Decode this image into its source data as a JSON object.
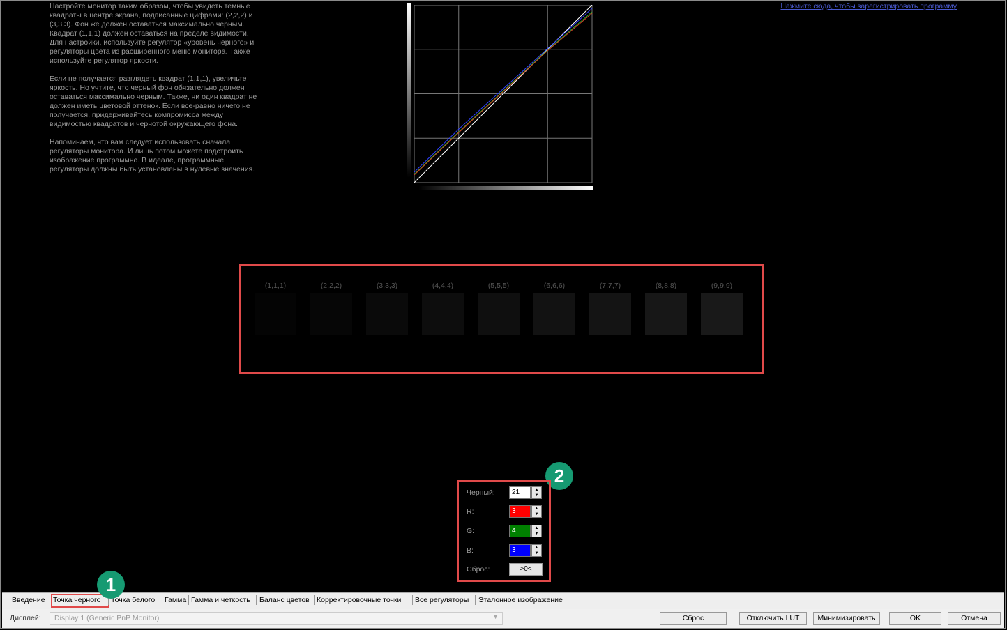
{
  "instructions": {
    "p1": "Настройте монитор таким образом, чтобы увидеть темные квадраты в центре экрана, подписанные цифрами: (2,2,2) и (3,3,3). Фон же должен оставаться максимально черным. Квадрат (1,1,1) должен оставаться на пределе видимости. Для настройки, используйте регулятор «уровень черного» и регуляторы цвета из расширенного меню монитора. Также используйте регулятор яркости.",
    "p2": "Если не получается разглядеть квадрат (1,1,1), увеличьте яркость. Но учтите, что черный фон обязательно должен оставаться максимально черным. Также, ни один квадрат не должен иметь цветовой оттенок. Если все-равно ничего не получается, придерживайтесь компромисса между видимостью квадратов и чернотой окружающего фона.",
    "p3": "Напоминаем, что вам следует использовать сначала регуляторы монитора. И лишь потом можете подстроить изображение программно. В идеале, программные регуляторы должны быть установлены в нулевые значения."
  },
  "register_link": "Нажмите сюда, чтобы зарегистрировать программу",
  "squares": [
    {
      "label": "(1,1,1)",
      "color": "#040404"
    },
    {
      "label": "(2,2,2)",
      "color": "#060606"
    },
    {
      "label": "(3,3,3)",
      "color": "#0a0a0a"
    },
    {
      "label": "(4,4,4)",
      "color": "#0d0d0d"
    },
    {
      "label": "(5,5,5)",
      "color": "#0f0f0f"
    },
    {
      "label": "(6,6,6)",
      "color": "#121212"
    },
    {
      "label": "(7,7,7)",
      "color": "#141414"
    },
    {
      "label": "(8,8,8)",
      "color": "#171717"
    },
    {
      "label": "(9,9,9)",
      "color": "#191919"
    }
  ],
  "controls": {
    "black_label": "Черный:",
    "black_value": "21",
    "r_label": "R:",
    "r_value": "3",
    "g_label": "G:",
    "g_value": "4",
    "b_label": "B:",
    "b_value": "3",
    "reset_label": "Сброс:",
    "reset_button": ">0<"
  },
  "badges": {
    "one": "1",
    "two": "2"
  },
  "tabs": [
    "Введение",
    "Точка черного",
    "Точка белого",
    "Гамма",
    "Гамма и четкость",
    "Баланс цветов",
    "Корректировочные точки",
    "Все регуляторы",
    "Эталонное изображение"
  ],
  "active_tab": "Точка черного",
  "bottom": {
    "display_label": "Дисплей:",
    "display_value": "Display 1 (Generic PnP Monitor)",
    "buttons": [
      "Сброс",
      "Отключить LUT",
      "Минимизировать",
      "OK",
      "Отмена"
    ]
  },
  "colors": {
    "highlight": "#e04a4a",
    "badge": "#169a72",
    "link": "#4a5ad0",
    "red": "#ff0000",
    "green": "#008000",
    "blue": "#0000ff"
  }
}
